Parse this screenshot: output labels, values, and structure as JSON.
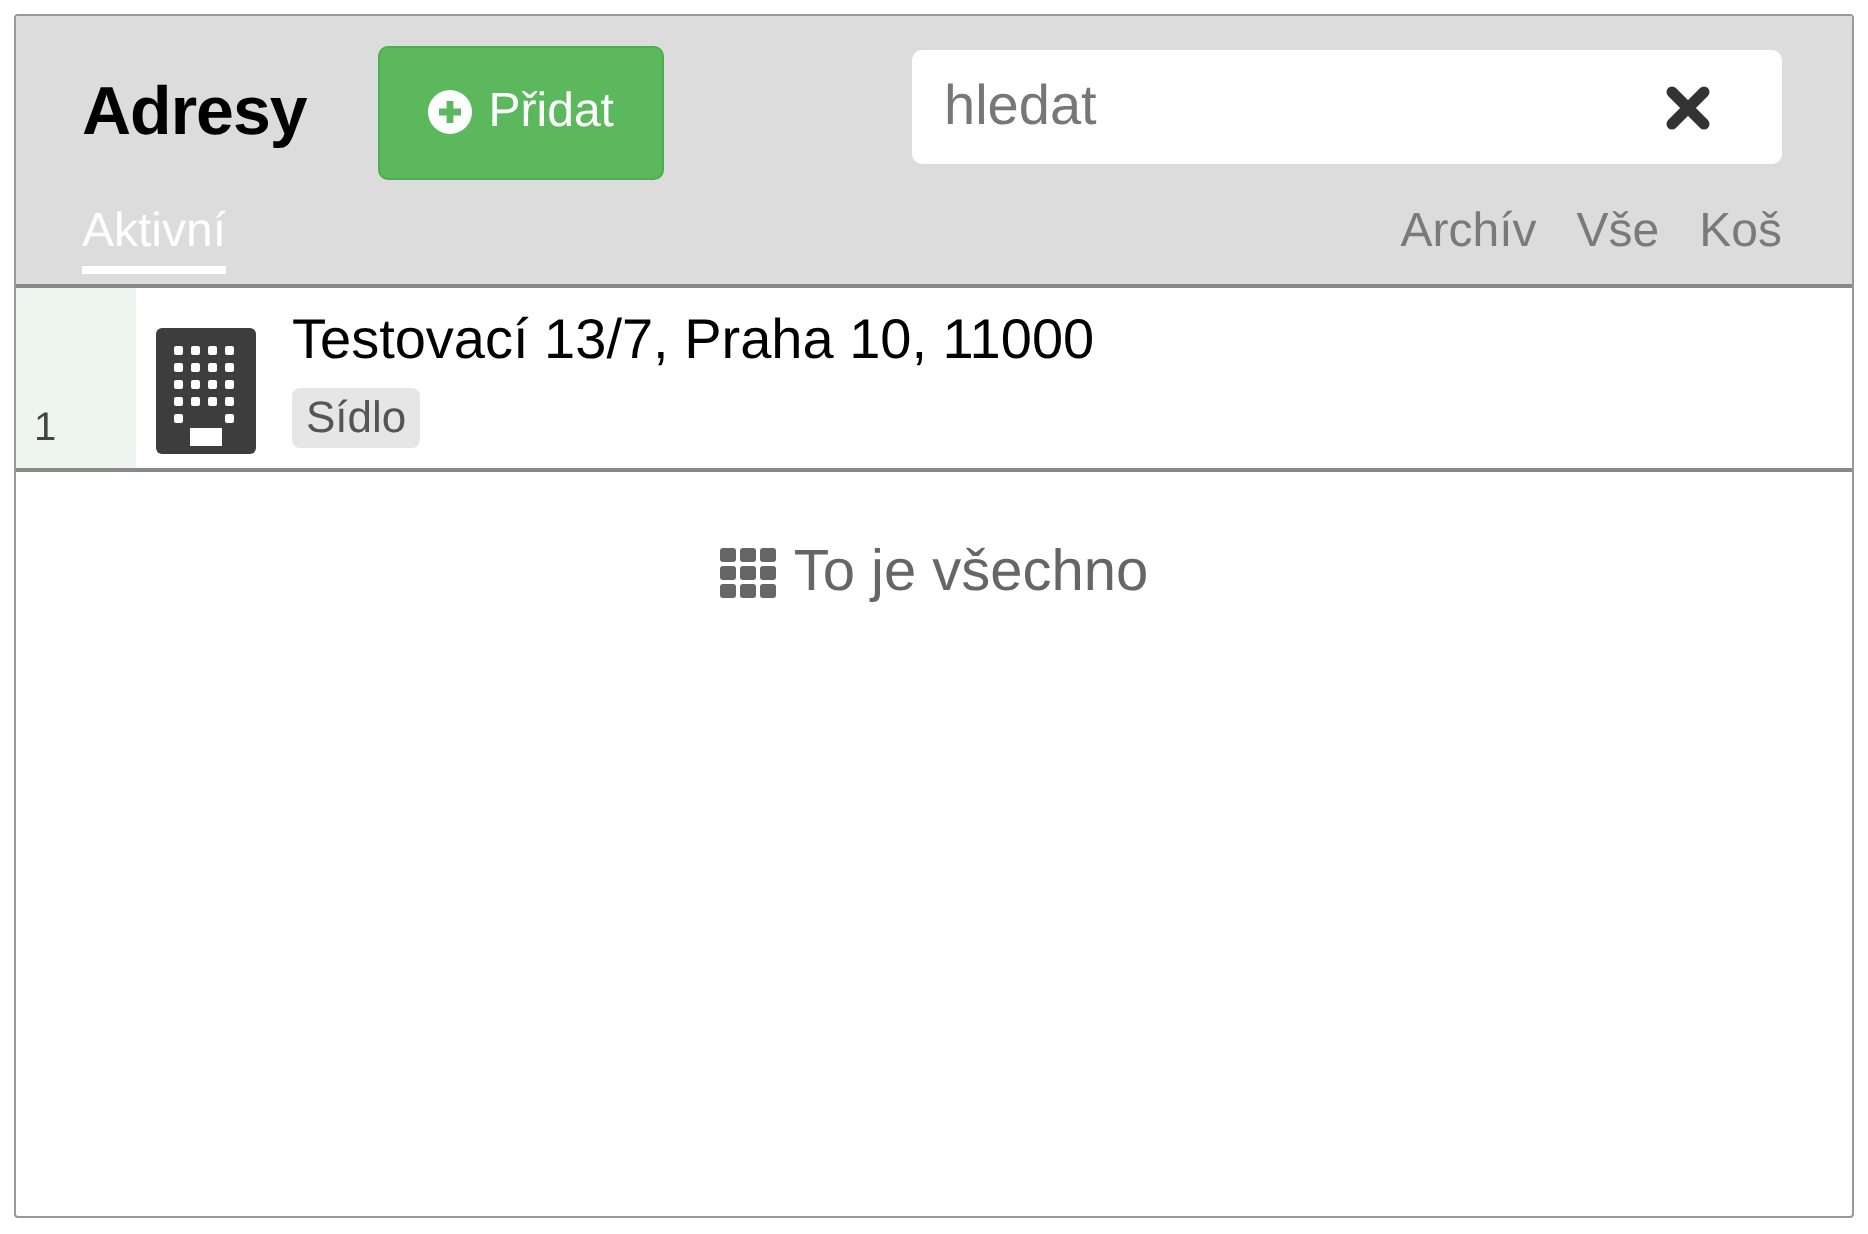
{
  "header": {
    "title": "Adresy",
    "add_button": {
      "label": "Přidat"
    },
    "search": {
      "placeholder": "hledat"
    }
  },
  "tabs": [
    {
      "label": "Aktivní",
      "selected": true
    },
    {
      "label": "Archív",
      "selected": false
    },
    {
      "label": "Vše",
      "selected": false
    },
    {
      "label": "Koš",
      "selected": false
    }
  ],
  "rows": [
    {
      "index": "1",
      "address": "Testovací 13/7, Praha 10, 11000",
      "tag": "Sídlo"
    }
  ],
  "footer": {
    "text": "To je všechno"
  }
}
